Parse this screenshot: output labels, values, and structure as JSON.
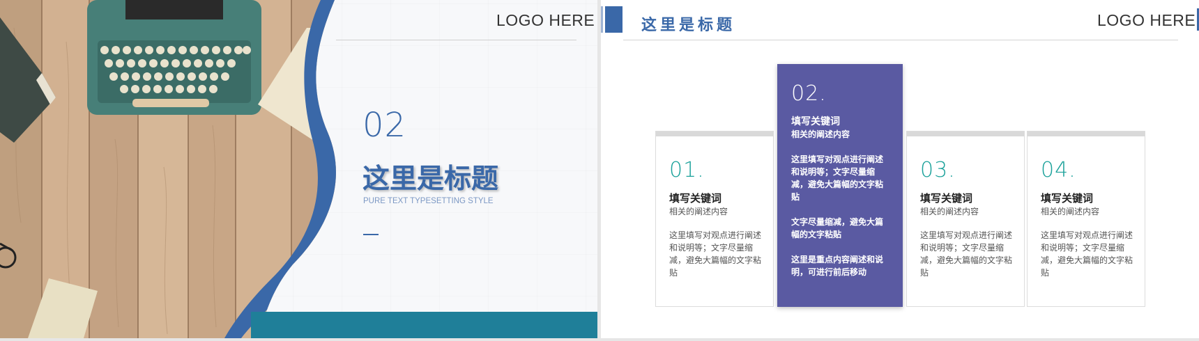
{
  "left_slide": {
    "logo": "LOGO HERE",
    "number": "02",
    "title": "这里是标题",
    "subtitle": "PURE TEXT TYPESETTING STYLE",
    "colors": {
      "accent": "#3a68a8",
      "bottom_bar": "#1f7f99",
      "wood": "#caa987"
    }
  },
  "right_slide": {
    "title": "这里是标题",
    "logo": "LOGO HERE",
    "cards": [
      {
        "number": "01.",
        "keyword": "填写关键词",
        "subtitle": "相关的阐述内容",
        "body": "这里填写对观点进行阐述和说明等；文字尽量缩减，避免大篇幅的文字粘贴"
      },
      {
        "number": "02.",
        "keyword": "填写关键词",
        "subtitle": "相关的阐述内容",
        "paragraphs": [
          "这里填写对观点进行阐述和说明等；文字尽量缩减，避免大篇幅的文字粘贴",
          "文字尽量缩减，避免大篇幅的文字粘贴",
          "这里是重点内容阐述和说明，可进行前后移动"
        ]
      },
      {
        "number": "03.",
        "keyword": "填写关键词",
        "subtitle": "相关的阐述内容",
        "body": "这里填写对观点进行阐述和说明等；文字尽量缩减，避免大篇幅的文字粘贴"
      },
      {
        "number": "04.",
        "keyword": "填写关键词",
        "subtitle": "相关的阐述内容",
        "body": "这里填写对观点进行阐述和说明等；文字尽量缩减，避免大篇幅的文字粘贴"
      }
    ],
    "colors": {
      "accent": "#3a68a8",
      "highlight_card": "#5a5aa2",
      "number_teal": "#1aa19a"
    }
  }
}
